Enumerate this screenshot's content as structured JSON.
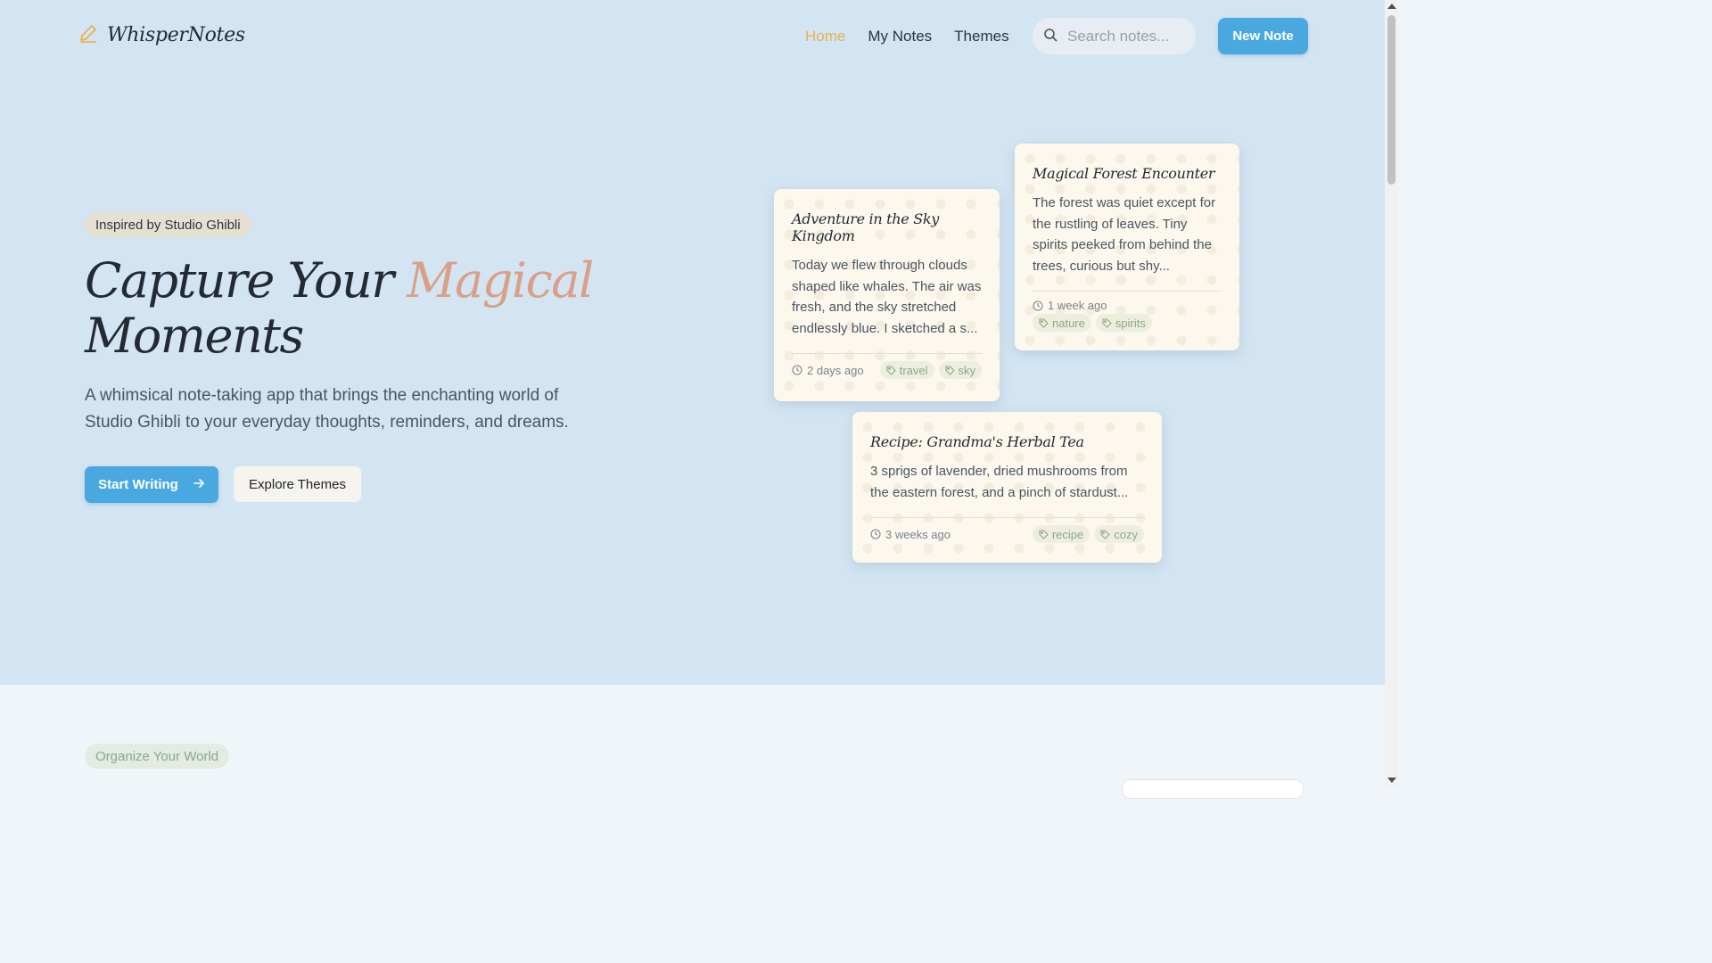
{
  "colors": {
    "accent": "#e8b14f",
    "primary": "#4aa8e0",
    "highlight": "#d9a086",
    "tag": "#8aa98a",
    "hero_bg": "#d3e5f3"
  },
  "header": {
    "logo_icon": "pencil-icon",
    "logo_text": "WhisperNotes",
    "nav": [
      {
        "label": "Home",
        "active": true
      },
      {
        "label": "My Notes",
        "active": false
      },
      {
        "label": "Themes",
        "active": false
      }
    ],
    "search": {
      "placeholder": "Search notes...",
      "icon": "search-icon"
    },
    "new_note_label": "New Note"
  },
  "hero": {
    "badge": "Inspired by Studio Ghibli",
    "headline_part1": "Capture Your ",
    "headline_accent": "Magical",
    "headline_part2": "Moments",
    "subtitle": "A whimsical note-taking app that brings the enchanting world of Studio Ghibli to your everyday thoughts, reminders, and dreams.",
    "primary_button": "Start Writing",
    "primary_button_icon": "arrow-right-icon",
    "secondary_button": "Explore Themes"
  },
  "notes": [
    {
      "title": "Adventure in the Sky Kingdom",
      "body": "Today we flew through clouds shaped like whales. The air was fresh, and the sky stretched endlessly blue. I sketched a s...",
      "time": "2 days ago",
      "tags": [
        "travel",
        "sky"
      ]
    },
    {
      "title": "Magical Forest Encounter",
      "body": "The forest was quiet except for the rustling of leaves. Tiny spirits peeked from behind the trees, curious but shy...",
      "time": "1 week ago",
      "tags": [
        "nature",
        "spirits"
      ]
    },
    {
      "title": "Recipe: Grandma's Herbal Tea",
      "body": "3 sprigs of lavender, dried mushrooms from the eastern forest, and a pinch of stardust...",
      "time": "3 weeks ago",
      "tags": [
        "recipe",
        "cozy"
      ]
    }
  ],
  "section": {
    "badge": "Organize Your World"
  }
}
